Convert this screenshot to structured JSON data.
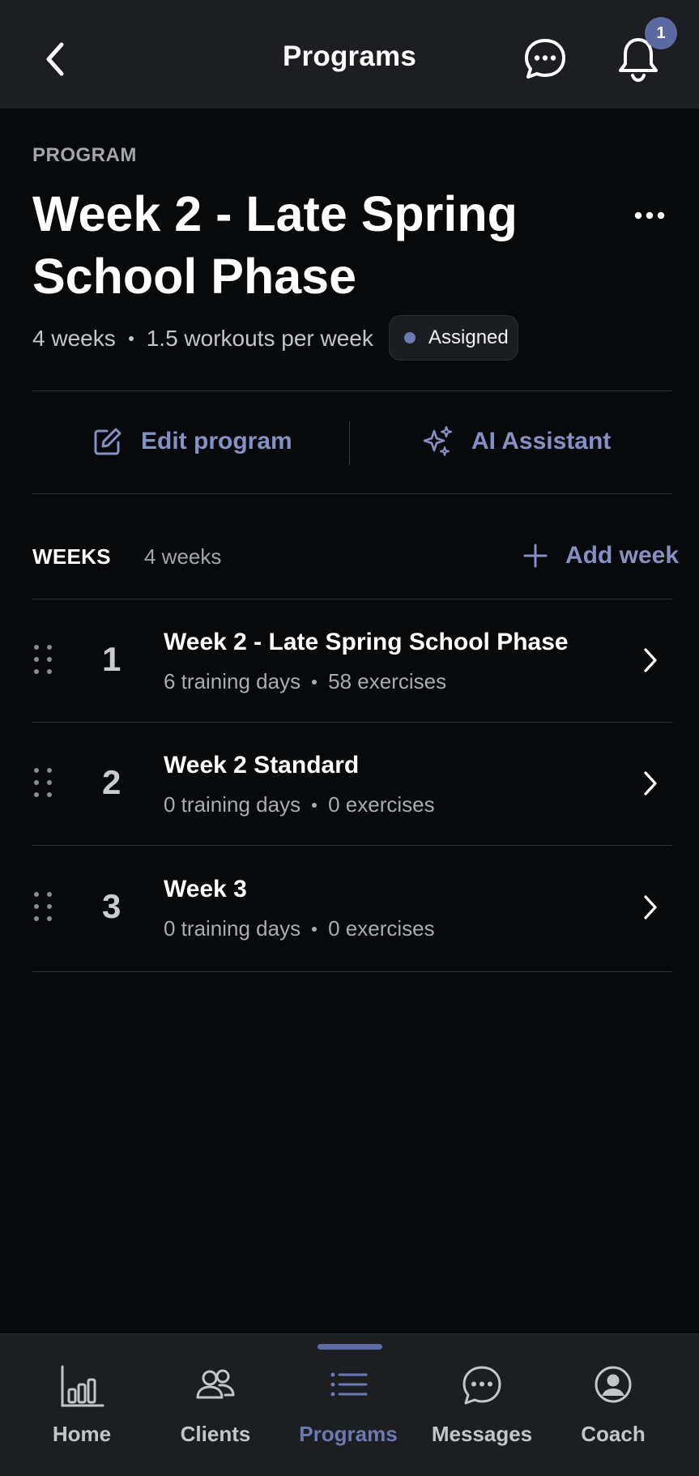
{
  "header": {
    "title": "Programs",
    "notification_count": "1"
  },
  "program": {
    "eyebrow": "PROGRAM",
    "title": "Week 2 - Late Spring School Phase",
    "weeks": "4 weeks",
    "frequency": "1.5 workouts per week",
    "status": "Assigned"
  },
  "actions": {
    "edit_label": "Edit program",
    "ai_label": "AI Assistant"
  },
  "weeks_section": {
    "label": "WEEKS",
    "count": "4 weeks",
    "add_label": "Add week",
    "items": [
      {
        "number": "1",
        "title": "Week 2 - Late Spring School Phase",
        "days": "6 training days",
        "exercises": "58 exercises"
      },
      {
        "number": "2",
        "title": "Week 2 Standard",
        "days": "0 training days",
        "exercises": "0 exercises"
      },
      {
        "number": "3",
        "title": "Week 3",
        "days": "0 training days",
        "exercises": "0 exercises"
      }
    ]
  },
  "nav": {
    "items": [
      {
        "label": "Home"
      },
      {
        "label": "Clients"
      },
      {
        "label": "Programs"
      },
      {
        "label": "Messages"
      },
      {
        "label": "Coach"
      }
    ]
  },
  "colors": {
    "accent": "#6c7ab3",
    "background": "#08090b",
    "bar": "#1c1e22"
  }
}
